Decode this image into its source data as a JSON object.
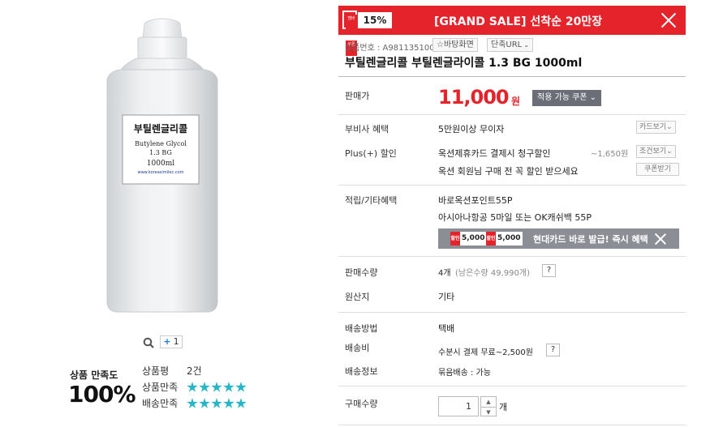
{
  "product_image": {
    "label_lines": [
      "부틸렌글리콜",
      "Butylene Glycol",
      "1.3 BG",
      "1000ml"
    ],
    "label_url": "www.koreasimilec.com"
  },
  "image_tools": {
    "zoom_icon": "search-icon",
    "add_count": "1"
  },
  "satisfaction": {
    "title": "상품 만족도",
    "percent": "100%",
    "review_label": "상품평",
    "review_count": "2건",
    "product_label": "상품만족",
    "shipping_label": "배송만족",
    "product_stars": 5,
    "shipping_stars": 5
  },
  "banner": {
    "tag": "멤버",
    "tag2": "쿠폰",
    "percent": "15%",
    "text": "[GRAND SALE] 선착순 20만장",
    "bg_color": "#e5232b"
  },
  "meta": {
    "product_no": "상품번호 : A981135100",
    "wish_label": "☆바탕화면",
    "short_url_label": "단축URL"
  },
  "product_title": "부틸렌글리콜 부틸렌글라이콜 1.3 BG 1000ml",
  "price": {
    "label": "판매가",
    "amount": "11,000",
    "unit": "원",
    "coupon_button": "적용 가능 쿠폰"
  },
  "benefits": {
    "vat_label": "부비사 혜택",
    "vat_value": "5만원이상 무이자",
    "card_button": "카드보기",
    "plus_label": "Plus(+) 할인",
    "plus_value": "옥션제휴카드 결제시 청구할인",
    "plus_discount": "~1,650원",
    "condition_button": "조건보기",
    "member_value": "옥션 회원님 구매 전 꼭 할인 받으세요",
    "coupon_receive_button": "쿠폰받기"
  },
  "points": {
    "label": "적립/기타혜택",
    "line1": "바로옥션포인트55P",
    "line2": "아시아나항공 5마일 또는 OK캐쉬백 55P"
  },
  "card_bar": {
    "mini1": "5,000",
    "mini2": "5,000",
    "mini_tag": "할인",
    "text": "현대카드 바로 발급! 즉시 혜택"
  },
  "sales": {
    "label": "판매수량",
    "value": "4개",
    "remaining": "(남은수량 49,990개)",
    "help": "?"
  },
  "origin": {
    "label": "원산지",
    "value": "기타"
  },
  "shipping": {
    "method_label": "배송방법",
    "method_value": "택배",
    "fee_label": "배송비",
    "fee_value": "수분시 결제 무료~2,500원",
    "help": "?",
    "info_label": "배송정보",
    "info_value": "묶음배송 : 가능"
  },
  "purchase": {
    "label": "구매수량",
    "quantity": "1",
    "unit": "개",
    "up": "▲",
    "down": "▼"
  }
}
